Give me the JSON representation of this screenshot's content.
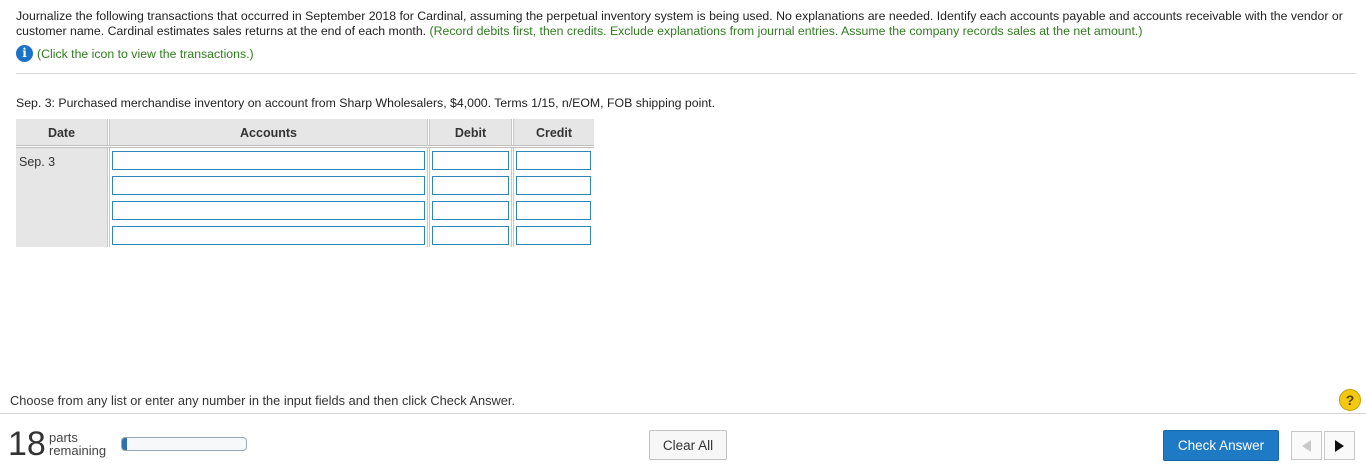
{
  "instructions": {
    "main": "Journalize the following transactions that occurred in September 2018 for Cardinal, assuming the perpetual inventory system is being used. No explanations are needed. Identify each accounts payable and accounts receivable with the vendor or customer name. Cardinal estimates sales returns at the end of each month.",
    "green": "(Record debits first, then credits. Exclude explanations from journal entries. Assume the company records sales at the net amount.)",
    "info_link": "(Click the icon to view the transactions.)"
  },
  "transaction": {
    "prompt": "Sep. 3: Purchased merchandise inventory on account from Sharp Wholesalers, $4,000. Terms 1/15, n/EOM, FOB shipping point."
  },
  "journal": {
    "headers": {
      "date": "Date",
      "accounts": "Accounts",
      "debit": "Debit",
      "credit": "Credit"
    },
    "date": "Sep. 3",
    "rows": [
      {
        "account": "",
        "debit": "",
        "credit": ""
      },
      {
        "account": "",
        "debit": "",
        "credit": ""
      },
      {
        "account": "",
        "debit": "",
        "credit": ""
      },
      {
        "account": "",
        "debit": "",
        "credit": ""
      }
    ]
  },
  "footer": {
    "hint": "Choose from any list or enter any number in the input fields and then click Check Answer.",
    "help_glyph": "?",
    "parts_count": "18",
    "parts_word": "parts",
    "remaining_word": "remaining",
    "progress_fraction": 0.04,
    "clear_all_label": "Clear All",
    "check_answer_label": "Check Answer"
  },
  "icons": {
    "info": "info-icon",
    "help": "question-icon",
    "prev": "triangle-left-icon",
    "next": "triangle-right-icon"
  },
  "colors": {
    "accent": "#1f7ac6",
    "green_text": "#2e7d1e",
    "input_border": "#2f86b8",
    "help": "#f2c811"
  }
}
